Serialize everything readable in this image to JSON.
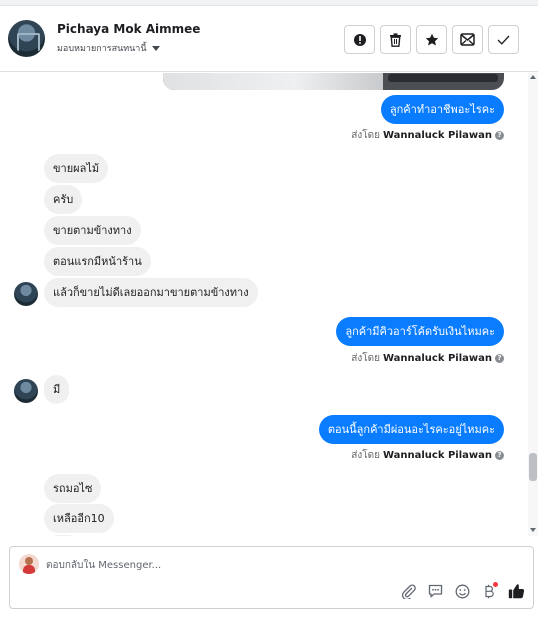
{
  "header": {
    "contact_name": "Pichaya Mok Aimmee",
    "assign_label": "มอบหมายการสนทนานี้",
    "actions": [
      "spam-icon",
      "trash-icon",
      "star-icon",
      "unread-icon",
      "check-icon"
    ]
  },
  "messages": [
    {
      "direction": "out",
      "text": "ลูกค้าทำอาชีพอะไรคะ"
    },
    {
      "direction": "out_meta",
      "sent_by_label": "ส่งโดย",
      "sender": "Wannaluck Pilawan"
    },
    {
      "direction": "in",
      "text": "ขายผลไม้"
    },
    {
      "direction": "in",
      "text": "ครับ"
    },
    {
      "direction": "in",
      "text": "ขายตามข้างทาง"
    },
    {
      "direction": "in",
      "text": "ตอนแรกมีหน้าร้าน"
    },
    {
      "direction": "in",
      "text": "แล้วก็ขายไม่ดีเลยออกมาขายตามข้างทาง"
    },
    {
      "direction": "out",
      "text": "ลูกค้ามีคิวอาร์โค้ดรับเงินไหมคะ"
    },
    {
      "direction": "out_meta",
      "sent_by_label": "ส่งโดย",
      "sender": "Wannaluck Pilawan"
    },
    {
      "direction": "in",
      "text": "มี"
    },
    {
      "direction": "out",
      "text": "ตอนนี้ลูกค้ามีผ่อนอะไรคะอยู่ไหมคะ"
    },
    {
      "direction": "out_meta",
      "sent_by_label": "ส่งโดย",
      "sender": "Wannaluck Pilawan"
    },
    {
      "direction": "in",
      "text": "รถมอไซ"
    },
    {
      "direction": "in",
      "text": "เหลืออีก10"
    }
  ],
  "composer": {
    "placeholder": "ตอบกลับใน Messenger...",
    "tools": [
      "attachment-icon",
      "saved-reply-icon",
      "emoji-icon",
      "payment-icon",
      "like-icon"
    ]
  },
  "colors": {
    "outgoing_bubble": "#0a7cff",
    "incoming_bubble": "#f0f0f0"
  }
}
